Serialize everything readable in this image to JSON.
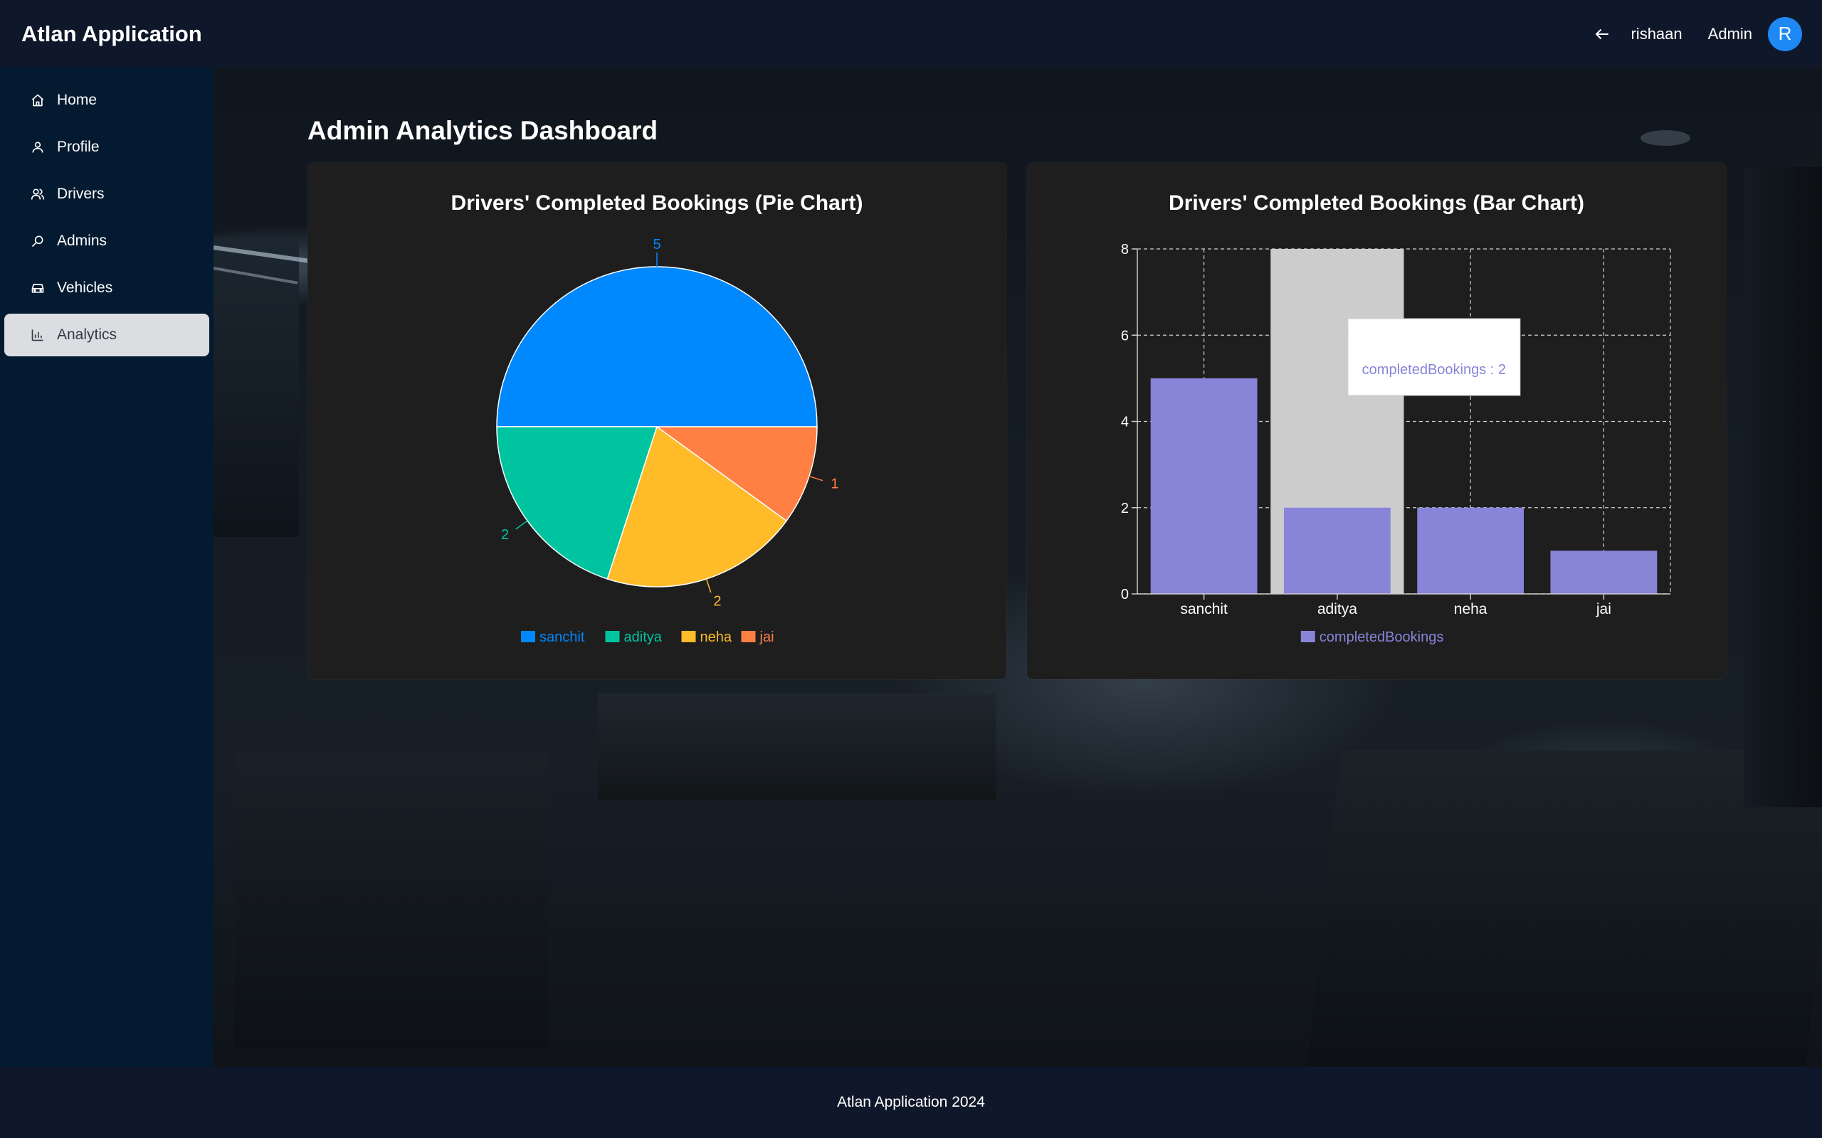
{
  "header": {
    "title": "Atlan Application",
    "username": "rishaan",
    "role": "Admin",
    "avatar_initial": "R",
    "back_icon": "arrow-left-icon"
  },
  "sidebar": {
    "items": [
      {
        "label": "Home",
        "icon": "home-icon",
        "active": false
      },
      {
        "label": "Profile",
        "icon": "user-icon",
        "active": false
      },
      {
        "label": "Drivers",
        "icon": "users-icon",
        "active": false
      },
      {
        "label": "Admins",
        "icon": "search-icon",
        "active": false
      },
      {
        "label": "Vehicles",
        "icon": "car-icon",
        "active": false
      },
      {
        "label": "Analytics",
        "icon": "bar-chart-icon",
        "active": true
      }
    ]
  },
  "main": {
    "title": "Admin Analytics Dashboard"
  },
  "footer": {
    "text": "Atlan Application 2024"
  },
  "colors": {
    "sanchit": "#0088fe",
    "aditya": "#00c49f",
    "neha": "#ffbb28",
    "jai": "#ff8042",
    "bar": "#8884d8",
    "active_highlight": "#cccccc"
  },
  "chart_data": [
    {
      "type": "pie",
      "title": "Drivers' Completed Bookings (Pie Chart)",
      "categories": [
        "sanchit",
        "aditya",
        "neha",
        "jai"
      ],
      "values": [
        5,
        2,
        2,
        1
      ],
      "legend": "bottom"
    },
    {
      "type": "bar",
      "title": "Drivers' Completed Bookings (Bar Chart)",
      "categories": [
        "sanchit",
        "aditya",
        "neha",
        "jai"
      ],
      "series": [
        {
          "name": "completedBookings",
          "values": [
            5,
            2,
            2,
            1
          ]
        }
      ],
      "ylim": [
        0,
        8
      ],
      "yticks": [
        0,
        2,
        4,
        6,
        8
      ],
      "grid": true,
      "legend": "bottom",
      "tooltip": {
        "category": "aditya",
        "text": "completedBookings : 2"
      }
    }
  ]
}
